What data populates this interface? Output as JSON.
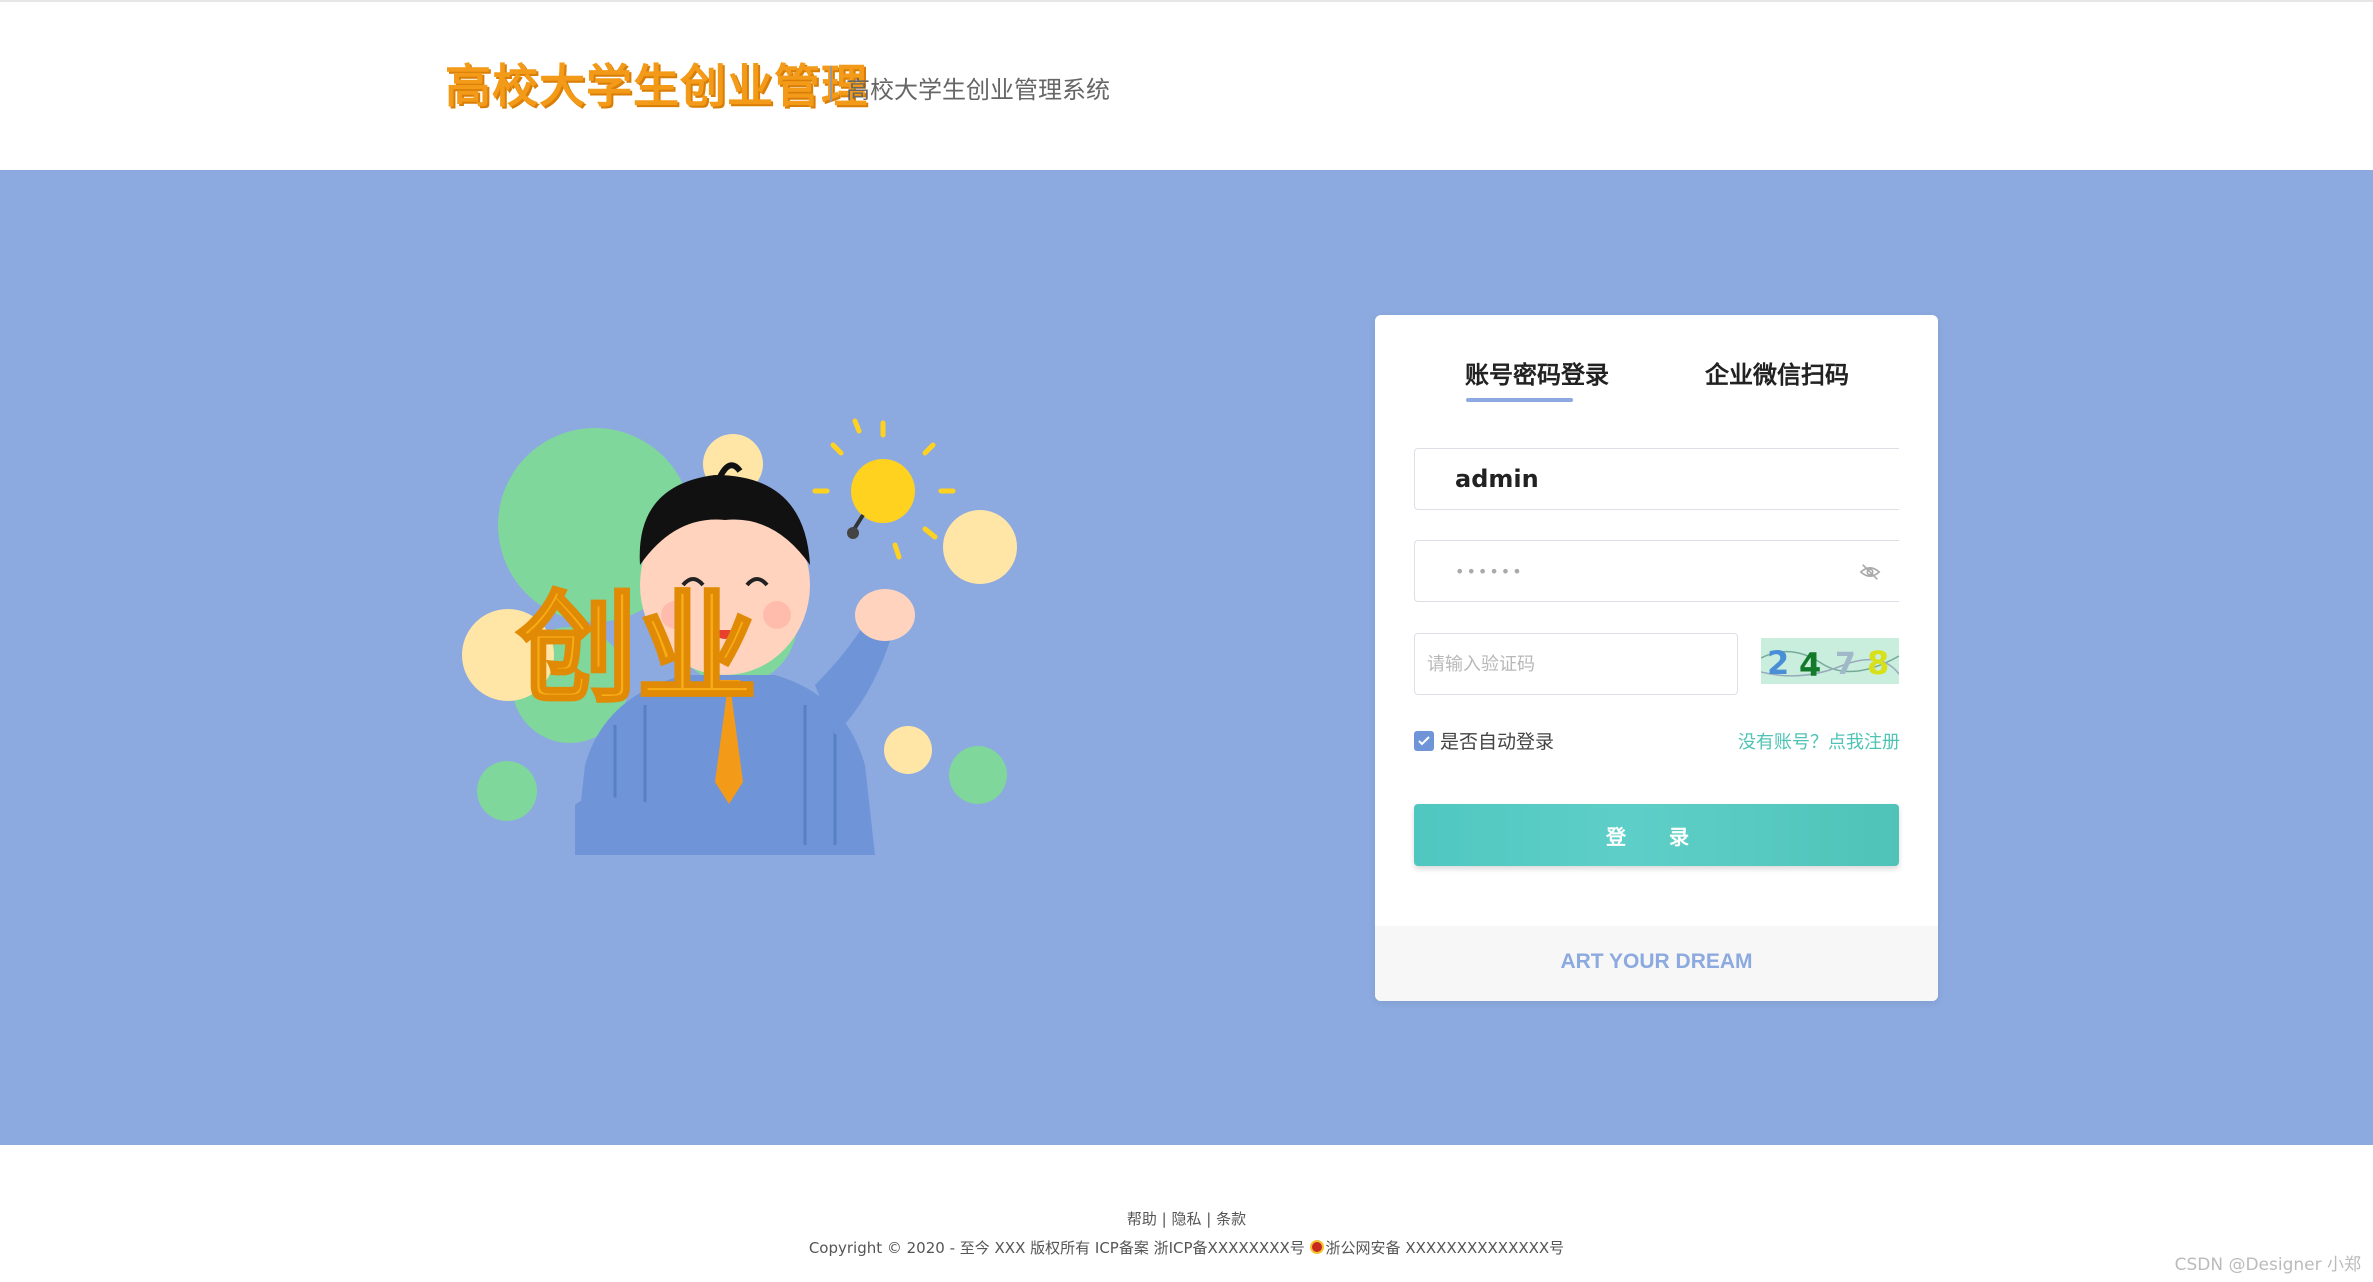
{
  "header": {
    "logo_text": "高校大学生创业管理",
    "subtitle": "高校大学生创业管理系统"
  },
  "colors": {
    "band": "#8caae0",
    "accent": "#4fc7c0",
    "logo": "#f39a18"
  },
  "illustration": {
    "text": "创业"
  },
  "login": {
    "tabs": [
      {
        "label": "账号密码登录",
        "active": true
      },
      {
        "label": "企业微信扫码",
        "active": false
      }
    ],
    "username_value": "admin",
    "password_value": "••••••",
    "captcha_placeholder": "请输入验证码",
    "captcha_digits": [
      "2",
      "4",
      "7",
      "8"
    ],
    "remember_label": "是否自动登录",
    "remember_checked": true,
    "register_link": "没有账号？点我注册",
    "submit_label": "登 录",
    "footer_slogan": "ART YOUR DREAM"
  },
  "footer": {
    "links": [
      "帮助",
      "隐私",
      "条款"
    ],
    "copyright": "Copyright © 2020 - 至今 XXX 版权所有 ICP备案 浙ICP备XXXXXXXX号",
    "police": "浙公网安备 XXXXXXXXXXXXXX号"
  },
  "watermark": "CSDN @Designer 小郑"
}
